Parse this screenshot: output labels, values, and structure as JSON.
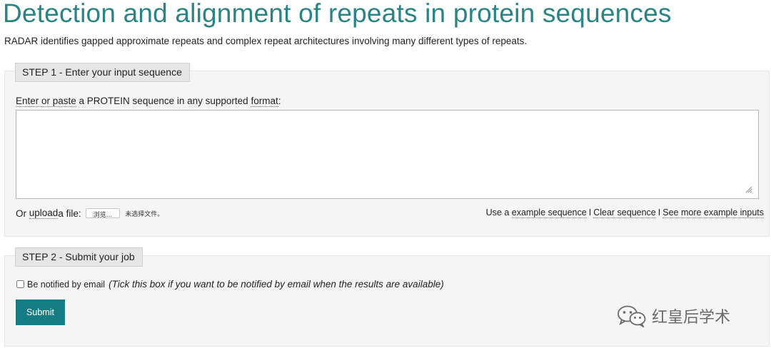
{
  "header": {
    "title": "Detection and alignment of repeats in protein sequences",
    "intro": "RADAR identifies gapped approximate repeats and complex repeat architectures involving many different types of repeats."
  },
  "step1": {
    "label": "STEP 1 - Enter your input sequence",
    "prompt_a": "Enter or paste",
    "prompt_b": " a PROTEIN sequence in any supported ",
    "prompt_c": "format",
    "prompt_d": ":",
    "sequence_value": "",
    "upload_a": "Or ",
    "upload_b": "upload",
    "upload_c": " a file:",
    "browse_label": "浏览...",
    "no_file_text": "未选择文件。",
    "use_text": "Use a ",
    "example_link": "example sequence",
    "separator": "I",
    "clear_link": "Clear sequence",
    "more_link": "See more example inputs"
  },
  "step2": {
    "label": "STEP 2 - Submit your job",
    "notify_label": "Be notified by email",
    "notify_hint": "(Tick this box if you want to be notified by email when the results are available)",
    "notify_checked": false,
    "submit_label": "Submit"
  },
  "watermark": {
    "text": "红皇后学术",
    "icon": "wechat-icon"
  },
  "colors": {
    "title": "#2a8486",
    "submit_bg": "#147c82",
    "panel_bg": "#f5f5f5"
  }
}
